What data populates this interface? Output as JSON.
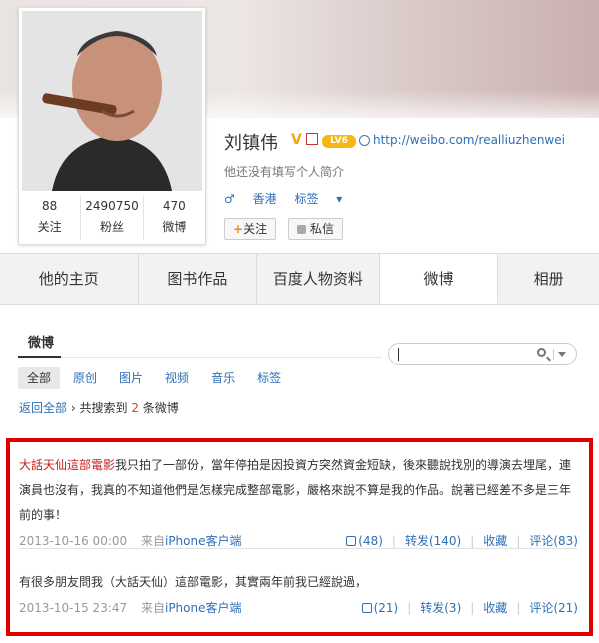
{
  "profile": {
    "name": "刘镇伟",
    "level": "LV6",
    "url": "http://weibo.com/realliuzhenwei",
    "intro": "他还没有填写个人简介",
    "gender_symbol": "♂",
    "location": "香港",
    "tags_label": "标签",
    "follow_label": "关注",
    "message_label": "私信"
  },
  "stats": [
    {
      "num": "88",
      "label": "关注"
    },
    {
      "num": "2490750",
      "label": "粉丝"
    },
    {
      "num": "470",
      "label": "微博"
    }
  ],
  "tabs": [
    "他的主页",
    "图书作品",
    "百度人物资料",
    "微博",
    "相册"
  ],
  "section_title": "微博",
  "filters": [
    "全部",
    "原创",
    "图片",
    "视频",
    "音乐",
    "标签"
  ],
  "breadcrumb": {
    "back": "返回全部",
    "prefix": "共搜索到",
    "count": "2",
    "suffix": "条微博"
  },
  "posts": [
    {
      "tag": "大話天仙這部電影",
      "text": "我只拍了一部份，當年停拍是因投資方突然資金短缺，後來聽說找別的導演去埋尾，連演員也沒有，我真的不知道他們是怎樣完成整部電影，嚴格來說不算是我的作品。說著已經差不多是三年前的事！",
      "time": "2013-10-16 00:00",
      "source_prefix": "来自",
      "source": "iPhone客户端",
      "likes": "(48)",
      "repost": "转发(140)",
      "fav": "收藏",
      "comment": "评论(83)"
    },
    {
      "tag": "",
      "text": "有很多朋友問我（大話天仙）這部電影，其實兩年前我已經說過，",
      "time": "2013-10-15 23:47",
      "source_prefix": "来自",
      "source": "iPhone客户端",
      "likes": "(21)",
      "repost": "转发(3)",
      "fav": "收藏",
      "comment": "评论(21)"
    }
  ],
  "colors": {
    "link": "#2e6fb7",
    "highlight_border": "#e00000",
    "topic_red": "#c21f1f"
  }
}
